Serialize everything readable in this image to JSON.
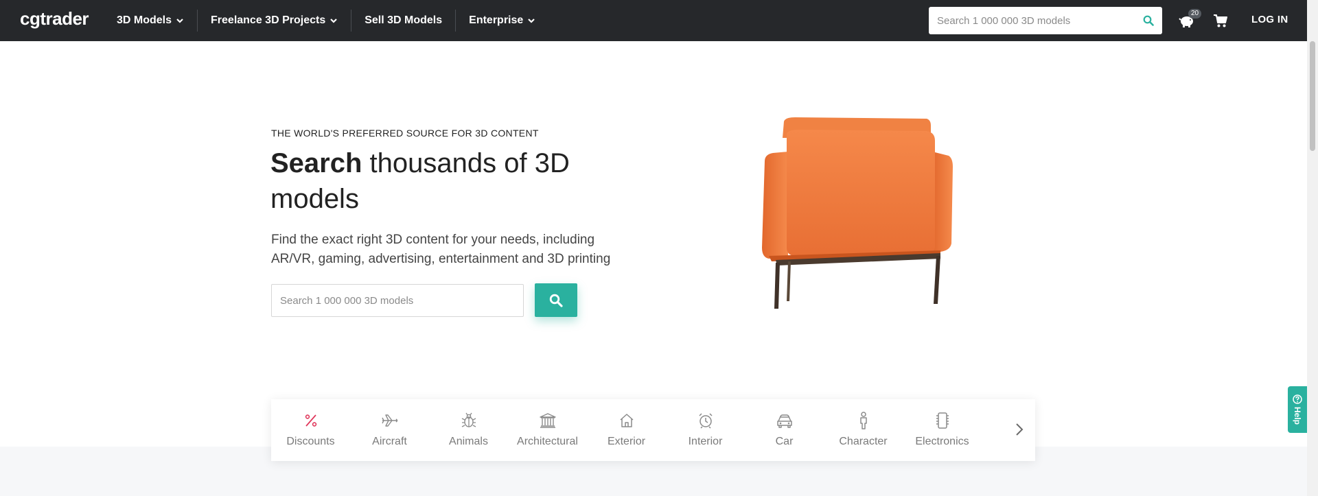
{
  "brand": {
    "logo_text": "cgtrader",
    "accent_color": "#2ab19f",
    "topbar_color": "#26282b",
    "discount_color": "#e0385c"
  },
  "nav": {
    "items": [
      {
        "label": "3D Models",
        "has_dropdown": true
      },
      {
        "label": "Freelance 3D Projects",
        "has_dropdown": true
      },
      {
        "label": "Sell 3D Models",
        "has_dropdown": false
      },
      {
        "label": "Enterprise",
        "has_dropdown": true
      }
    ],
    "search_placeholder": "Search 1 000 000 3D models",
    "piggy_badge": "20",
    "login_label": "LOG IN"
  },
  "hero": {
    "kicker": "THE WORLD'S PREFERRED SOURCE FOR 3D CONTENT",
    "title_bold": "Search",
    "title_rest": " thousands of 3D models",
    "description": "Find the exact right 3D content for your needs, including AR/VR, gaming, advertising, entertainment and 3D printing",
    "search_placeholder": "Search 1 000 000 3D models"
  },
  "categories": [
    {
      "label": "Discounts",
      "icon": "percent-icon"
    },
    {
      "label": "Aircraft",
      "icon": "airplane-icon"
    },
    {
      "label": "Animals",
      "icon": "bug-icon"
    },
    {
      "label": "Architectural",
      "icon": "building-columns-icon"
    },
    {
      "label": "Exterior",
      "icon": "house-icon"
    },
    {
      "label": "Interior",
      "icon": "alarm-clock-icon"
    },
    {
      "label": "Car",
      "icon": "car-icon"
    },
    {
      "label": "Character",
      "icon": "person-icon"
    },
    {
      "label": "Electronics",
      "icon": "chip-icon"
    }
  ],
  "help_label": "Help"
}
